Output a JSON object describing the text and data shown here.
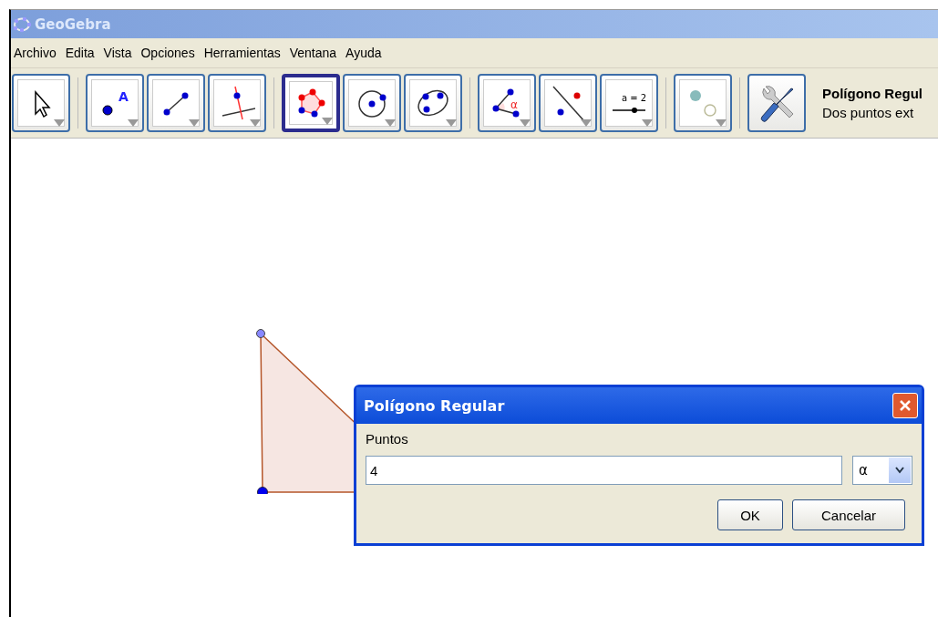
{
  "window": {
    "title": "GeoGebra"
  },
  "menu": [
    "Archivo",
    "Edita",
    "Vista",
    "Opciones",
    "Herramientas",
    "Ventana",
    "Ayuda"
  ],
  "tool_groups": [
    {
      "tools": [
        {
          "kind": "pointer",
          "selected": false
        }
      ]
    },
    {
      "tools": [
        {
          "kind": "point",
          "label": "A",
          "selected": false
        },
        {
          "kind": "segment",
          "selected": false
        },
        {
          "kind": "perpendicular",
          "selected": false
        }
      ]
    },
    {
      "tools": [
        {
          "kind": "polygon",
          "selected": true
        },
        {
          "kind": "circle",
          "selected": false
        },
        {
          "kind": "ellipse",
          "selected": false
        }
      ]
    },
    {
      "tools": [
        {
          "kind": "angle",
          "label": "α",
          "selected": false
        },
        {
          "kind": "reflect",
          "selected": false
        },
        {
          "kind": "slider",
          "label": "a = 2",
          "selected": false
        }
      ]
    },
    {
      "tools": [
        {
          "kind": "show-hide",
          "selected": false
        }
      ]
    }
  ],
  "settings_button": {
    "kind": "tools"
  },
  "tool_help": {
    "name": "Polígono Regul",
    "description": "Dos puntos ext"
  },
  "dialog": {
    "title": "Polígono Regular",
    "label": "Puntos",
    "value": "4",
    "symbol": "α",
    "buttons": [
      "OK",
      "Cancelar"
    ]
  }
}
